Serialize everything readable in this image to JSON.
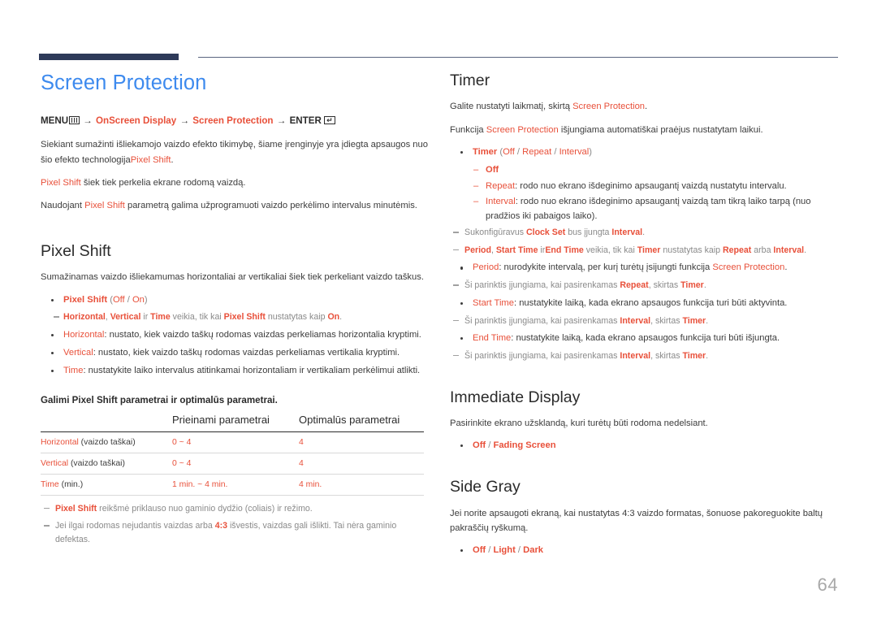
{
  "page": {
    "number": "64"
  },
  "left": {
    "title": "Screen Protection",
    "menu_path": {
      "menu": "MENU",
      "arrow1": "→",
      "item1": "OnScreen Display",
      "arrow2": "→",
      "item2": "Screen Protection",
      "arrow3": "→",
      "enter": "ENTER"
    },
    "intro": [
      {
        "parts": [
          {
            "t": "Siekiant sumažinti išliekamojo vaizdo efekto tikimybę, šiame įrenginyje yra įdiegta apsaugos nuo šio efekto technologija",
            "c": "dk"
          },
          {
            "t": "Pixel Shift",
            "c": "rd"
          },
          {
            "t": ".",
            "c": "dk"
          }
        ]
      },
      {
        "parts": [
          {
            "t": "Pixel Shift",
            "c": "rd"
          },
          {
            "t": " šiek tiek perkelia ekrane rodomą vaizdą.",
            "c": "dk"
          }
        ]
      },
      {
        "parts": [
          {
            "t": "Naudojant ",
            "c": "dk"
          },
          {
            "t": "Pixel Shift",
            "c": "rd"
          },
          {
            "t": " parametrą galima užprogramuoti vaizdo perkėlimo intervalus minutėmis.",
            "c": "dk"
          }
        ]
      }
    ],
    "pixel_shift": {
      "heading": "Pixel Shift",
      "desc": "Sumažinamas vaizdo išliekamumas horizontaliai ar vertikaliai šiek tiek perkeliant vaizdo taškus.",
      "items": [
        {
          "kind": "bullet",
          "parts": [
            {
              "t": "Pixel Shift",
              "c": "rd-b"
            },
            {
              "t": " (",
              "c": "gy"
            },
            {
              "t": "Off",
              "c": "rd"
            },
            {
              "t": " / ",
              "c": "gy"
            },
            {
              "t": "On",
              "c": "rd"
            },
            {
              "t": ")",
              "c": "gy"
            }
          ]
        },
        {
          "kind": "note",
          "parts": [
            {
              "t": "Horizontal",
              "c": "rd-b"
            },
            {
              "t": ", ",
              "c": "gy"
            },
            {
              "t": "Vertical",
              "c": "rd-b"
            },
            {
              "t": " ir ",
              "c": "gy"
            },
            {
              "t": "Time",
              "c": "rd-b"
            },
            {
              "t": " veikia, tik kai ",
              "c": "gy"
            },
            {
              "t": "Pixel Shift",
              "c": "rd-b"
            },
            {
              "t": " nustatytas kaip ",
              "c": "gy"
            },
            {
              "t": "On",
              "c": "rd-b"
            },
            {
              "t": ".",
              "c": "gy"
            }
          ]
        },
        {
          "kind": "bullet",
          "parts": [
            {
              "t": "Horizontal",
              "c": "rd"
            },
            {
              "t": ": nustato, kiek vaizdo taškų rodomas vaizdas perkeliamas horizontalia kryptimi.",
              "c": "dk"
            }
          ]
        },
        {
          "kind": "bullet",
          "parts": [
            {
              "t": "Vertical",
              "c": "rd"
            },
            {
              "t": ": nustato, kiek vaizdo taškų rodomas vaizdas perkeliamas vertikalia kryptimi.",
              "c": "dk"
            }
          ]
        },
        {
          "kind": "bullet",
          "parts": [
            {
              "t": "Time",
              "c": "rd"
            },
            {
              "t": ": nustatykite laiko intervalus atitinkamai horizontaliam ir vertikaliam perkėlimui atlikti.",
              "c": "dk"
            }
          ]
        }
      ]
    },
    "table": {
      "intro": "Galimi Pixel Shift parametrai ir optimalūs parametrai.",
      "headers": [
        "",
        "Prieinami parametrai",
        "Optimalūs parametrai"
      ],
      "rows": [
        {
          "label": "Horizontal",
          "unit": " (vaizdo taškai)",
          "available": "0 ~ 4",
          "optimal": "4"
        },
        {
          "label": "Vertical",
          "unit": " (vaizdo taškai)",
          "available": "0 ~ 4",
          "optimal": "4"
        },
        {
          "label": "Time",
          "unit": " (min.)",
          "available": "1 min. ~ 4 min.",
          "optimal": "4 min."
        }
      ],
      "notes": [
        {
          "parts": [
            {
              "t": "Pixel Shift",
              "c": "rd-b"
            },
            {
              "t": " reikšmė priklauso nuo gaminio dydžio (coliais) ir režimo.",
              "c": "gy"
            }
          ]
        },
        {
          "parts": [
            {
              "t": "Jei ilgai rodomas nejudantis vaizdas arba ",
              "c": "gy"
            },
            {
              "t": "4:3",
              "c": "rd-b"
            },
            {
              "t": " išvestis, vaizdas gali išlikti. Tai nėra gaminio defektas.",
              "c": "gy"
            }
          ]
        }
      ]
    }
  },
  "right": {
    "timer": {
      "heading": "Timer",
      "desc": [
        {
          "parts": [
            {
              "t": "Galite nustatyti laikmatį, skirtą ",
              "c": "dk"
            },
            {
              "t": "Screen Protection",
              "c": "rd"
            },
            {
              "t": ".",
              "c": "dk"
            }
          ]
        },
        {
          "parts": [
            {
              "t": "Funkcija ",
              "c": "dk"
            },
            {
              "t": "Screen Protection",
              "c": "rd"
            },
            {
              "t": " išjungiama automatiškai praėjus nustatytam laikui.",
              "c": "dk"
            }
          ]
        }
      ],
      "items": [
        {
          "kind": "bullet",
          "parts": [
            {
              "t": "Timer",
              "c": "rd-b"
            },
            {
              "t": " (",
              "c": "gy"
            },
            {
              "t": "Off",
              "c": "rd"
            },
            {
              "t": " / ",
              "c": "gy"
            },
            {
              "t": "Repeat",
              "c": "rd"
            },
            {
              "t": " / ",
              "c": "gy"
            },
            {
              "t": "Interval",
              "c": "rd"
            },
            {
              "t": ")",
              "c": "gy"
            }
          ]
        },
        {
          "kind": "dash",
          "parts": [
            {
              "t": "Off",
              "c": "rd-b"
            }
          ]
        },
        {
          "kind": "dash",
          "parts": [
            {
              "t": "Repeat",
              "c": "rd"
            },
            {
              "t": ": rodo nuo ekrano išdeginimo apsaugantį vaizdą nustatytu intervalu.",
              "c": "dk"
            }
          ]
        },
        {
          "kind": "dash",
          "parts": [
            {
              "t": "Interval",
              "c": "rd"
            },
            {
              "t": ": rodo nuo ekrano išdeginimo apsaugantį vaizdą tam tikrą laiko tarpą (nuo pradžios iki pabaigos laiko).",
              "c": "dk"
            }
          ]
        },
        {
          "kind": "note",
          "parts": [
            {
              "t": "Sukonfigūravus ",
              "c": "gy"
            },
            {
              "t": "Clock Set",
              "c": "rd-b"
            },
            {
              "t": " bus įjungta ",
              "c": "gy"
            },
            {
              "t": "Interval",
              "c": "rd-b"
            },
            {
              "t": ".",
              "c": "gy"
            }
          ]
        },
        {
          "kind": "note",
          "parts": [
            {
              "t": "Period",
              "c": "rd-b"
            },
            {
              "t": ", ",
              "c": "gy"
            },
            {
              "t": "Start Time",
              "c": "rd-b"
            },
            {
              "t": " ir",
              "c": "gy"
            },
            {
              "t": "End Time",
              "c": "rd-b"
            },
            {
              "t": " veikia, tik kai ",
              "c": "gy"
            },
            {
              "t": "Timer",
              "c": "rd-b"
            },
            {
              "t": " nustatytas kaip ",
              "c": "gy"
            },
            {
              "t": "Repeat",
              "c": "rd-b"
            },
            {
              "t": " arba ",
              "c": "gy"
            },
            {
              "t": "Interval",
              "c": "rd-b"
            },
            {
              "t": ".",
              "c": "gy"
            }
          ]
        },
        {
          "kind": "bullet",
          "parts": [
            {
              "t": "Period",
              "c": "rd"
            },
            {
              "t": ": nurodykite intervalą, per kurį turėtų įsijungti funkcija ",
              "c": "dk"
            },
            {
              "t": "Screen Protection",
              "c": "rd"
            },
            {
              "t": ".",
              "c": "dk"
            }
          ]
        },
        {
          "kind": "note",
          "parts": [
            {
              "t": "Ši parinktis įjungiama, kai pasirenkamas ",
              "c": "gy"
            },
            {
              "t": "Repeat",
              "c": "rd-b"
            },
            {
              "t": ", skirtas ",
              "c": "gy"
            },
            {
              "t": "Timer",
              "c": "rd-b"
            },
            {
              "t": ".",
              "c": "gy"
            }
          ]
        },
        {
          "kind": "bullet",
          "parts": [
            {
              "t": "Start Time",
              "c": "rd"
            },
            {
              "t": ": nustatykite laiką, kada ekrano apsaugos funkcija turi būti aktyvinta.",
              "c": "dk"
            }
          ]
        },
        {
          "kind": "note",
          "parts": [
            {
              "t": "Ši parinktis įjungiama, kai pasirenkamas ",
              "c": "gy"
            },
            {
              "t": "Interval",
              "c": "rd-b"
            },
            {
              "t": ", skirtas ",
              "c": "gy"
            },
            {
              "t": "Timer",
              "c": "rd-b"
            },
            {
              "t": ".",
              "c": "gy"
            }
          ]
        },
        {
          "kind": "bullet",
          "parts": [
            {
              "t": "End Time",
              "c": "rd"
            },
            {
              "t": ": nustatykite laiką, kada ekrano apsaugos funkcija turi būti išjungta.",
              "c": "dk"
            }
          ]
        },
        {
          "kind": "note",
          "parts": [
            {
              "t": "Ši parinktis įjungiama, kai pasirenkamas ",
              "c": "gy"
            },
            {
              "t": "Interval",
              "c": "rd-b"
            },
            {
              "t": ", skirtas ",
              "c": "gy"
            },
            {
              "t": "Timer",
              "c": "rd-b"
            },
            {
              "t": ".",
              "c": "gy"
            }
          ]
        }
      ]
    },
    "immediate_display": {
      "heading": "Immediate Display",
      "desc": "Pasirinkite ekrano užsklandą, kuri turėtų būti rodoma nedelsiant.",
      "options": [
        {
          "kind": "bullet",
          "parts": [
            {
              "t": "Off",
              "c": "rd-b"
            },
            {
              "t": " / ",
              "c": "gy"
            },
            {
              "t": "Fading Screen",
              "c": "rd-b"
            }
          ]
        }
      ]
    },
    "side_gray": {
      "heading": "Side Gray",
      "desc": "Jei norite apsaugoti ekraną, kai nustatytas 4:3 vaizdo formatas, šonuose pakoreguokite baltų pakraščių ryškumą.",
      "options": [
        {
          "kind": "bullet",
          "parts": [
            {
              "t": "Off",
              "c": "rd-b"
            },
            {
              "t": " / ",
              "c": "gy"
            },
            {
              "t": "Light",
              "c": "rd-b"
            },
            {
              "t": " / ",
              "c": "gy"
            },
            {
              "t": "Dark",
              "c": "rd-b"
            }
          ]
        }
      ]
    }
  },
  "colors": {
    "accent_red": "#e8503a",
    "title_blue": "#3d8aee",
    "header_navy": "#2e3a59",
    "body_gray": "#3c3c3c",
    "muted_gray": "#8a8a8a"
  }
}
